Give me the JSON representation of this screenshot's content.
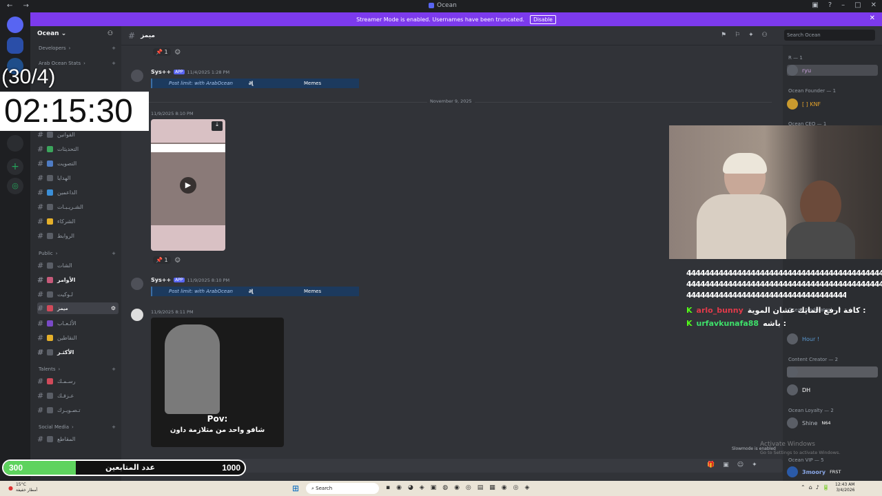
{
  "window": {
    "title": "Ocean"
  },
  "banner": {
    "text": "Streamer Mode is enabled. Usernames have been truncated.",
    "button": "Disable"
  },
  "server": {
    "name": "Ocean"
  },
  "sidebar": {
    "categories": [
      {
        "label": "Developers"
      },
      {
        "label": "Arab Ocean Stats"
      },
      {
        "label": "Public"
      },
      {
        "label": "Talents"
      },
      {
        "label": "Social Media"
      }
    ],
    "channels_top": [
      "القوانين",
      "التحديثات",
      "التصويت",
      "الهدايا",
      "الداعمين",
      "الشـريـبـات",
      "الشركاء",
      "الروابط"
    ],
    "channels_public": [
      "الشات",
      "الأوامر",
      "لـوكيت",
      "ميمز",
      "الألـعـاب",
      "النقاطين",
      "الأكثـر"
    ],
    "channels_talents": [
      "رسـمـك",
      "عـزفـك",
      "تـصـويـرك"
    ],
    "channels_social": [
      "المقاطع"
    ]
  },
  "channel": {
    "name": "ميمز"
  },
  "search": {
    "placeholder": "Search Ocean"
  },
  "messages": [
    {
      "name": "Sys++",
      "badge": "APP",
      "time": "11/4/2025 1:28 PM",
      "embed_left": "Post limit: with ArabOcean",
      "embed_right": "Memes"
    },
    {
      "name": "Sys++",
      "badge": "APP",
      "time": "11/9/2025 8:10 PM",
      "embed_left": "Post limit: with ArabOcean",
      "embed_right": "Memes"
    }
  ],
  "image_meta": [
    {
      "time": "11/9/2025 8:10 PM"
    },
    {
      "time": "11/9/2025 8:11 PM"
    }
  ],
  "reactions": {
    "count": "1"
  },
  "date_divider": "November 9, 2025",
  "image_caption": {
    "line1": "Pov:",
    "line2": "شافو واحد من متلازمة داون"
  },
  "members": {
    "groups": [
      {
        "label": "R — 1",
        "name": "ryu"
      },
      {
        "label": "Ocean Founder — 1",
        "name": "[ ] KNF"
      },
      {
        "label": "Ocean CEO — 1"
      },
      {
        "label": "Ocean Moderator — 2"
      },
      {
        "label": "Content Creator — 2"
      },
      {
        "label": "Ocean Loyalty — 2"
      },
      {
        "label": "Ocean VIP — 5",
        "name": "3moory"
      }
    ],
    "extra": [
      "Hour !",
      "DH",
      "Shine",
      "N64",
      "FRST"
    ]
  },
  "chat": [
    {
      "user": "arlo_bunny",
      "text": "كافة ارفع المايك عشان الموية :",
      "color": "#e23a4a"
    },
    {
      "user": "urfavkunafa88",
      "text": "باشه :",
      "color": "#3ee06a"
    }
  ],
  "overlay": {
    "counter": "(30/4)",
    "timer": "02:15:30",
    "follow_current": "300",
    "follow_label": "عدد المتابعين",
    "follow_goal": "1000",
    "follow_progress": 0.3
  },
  "windows_watermark": {
    "line1": "Activate Windows",
    "line2": "Go to Settings to activate Windows."
  },
  "slowmode": "Slowmode is enabled",
  "taskbar": {
    "weather_temp": "15°C",
    "weather_desc": "أمطار خفيفة",
    "search": "Search",
    "time": "12:43 AM",
    "date": "3/4/2026"
  }
}
